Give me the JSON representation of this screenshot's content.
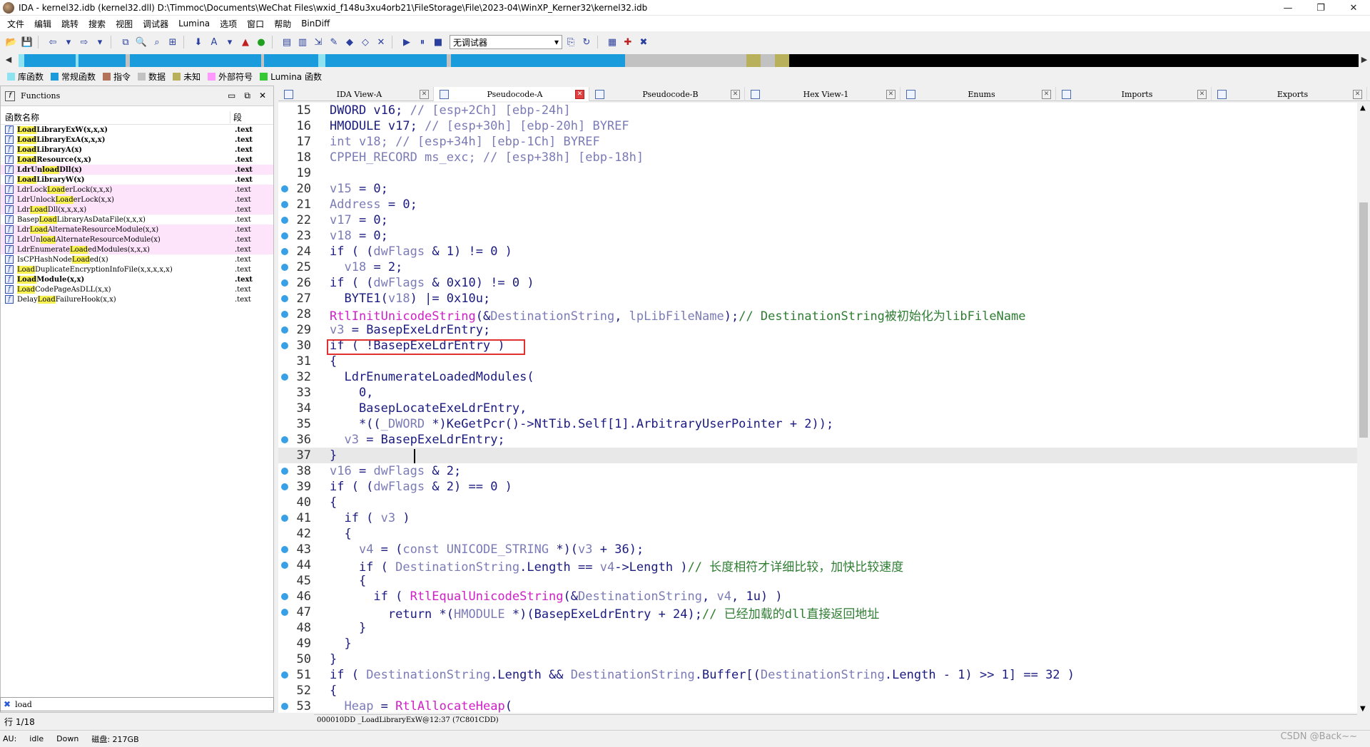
{
  "titlebar": {
    "title": "IDA - kernel32.idb (kernel32.dll) D:\\Timmoc\\Documents\\WeChat Files\\wxid_f148u3xu4orb21\\FileStorage\\File\\2023-04\\WinXP_Kerner32\\kernel32.idb",
    "minimize": "—",
    "maximize": "❐",
    "close": "✕"
  },
  "menubar": [
    "文件",
    "编辑",
    "跳转",
    "搜索",
    "视图",
    "调试器",
    "Lumina",
    "选项",
    "窗口",
    "帮助",
    "BinDiff"
  ],
  "toolbar": {
    "debugger_select": "无调试器",
    "icons": [
      "open-icon",
      "save-icon",
      "back-icon",
      "forward-icon",
      "copy-icon",
      "search-icon",
      "run-icon",
      "pause-icon",
      "stop-icon"
    ]
  },
  "navband": {
    "left_arrow": "◀",
    "right_arrow": "▶",
    "colors": {
      "library": "#8fe3f0",
      "regular": "#1a9bdc",
      "instruction": "#b2735a",
      "data": "#c2c2c2",
      "unexplored": "#b8b05a",
      "external": "#ff99ff",
      "lumina": "#35c935"
    }
  },
  "legend": [
    {
      "label": "库函数",
      "color": "#8fe3f0"
    },
    {
      "label": "常规函数",
      "color": "#1a9bdc"
    },
    {
      "label": "指令",
      "color": "#b2735a"
    },
    {
      "label": "数据",
      "color": "#c2c2c2"
    },
    {
      "label": "未知",
      "color": "#b8b05a"
    },
    {
      "label": "外部符号",
      "color": "#ff99ff"
    },
    {
      "label": "Lumina 函数",
      "color": "#35c935"
    }
  ],
  "functions": {
    "title": "Functions",
    "col_name": "函数名称",
    "col_seg": "段",
    "rows": [
      {
        "pre": "",
        "hl": "Load",
        "post": "LibraryExW(x,x,x)",
        "seg": ".text",
        "bold": true,
        "pink": false
      },
      {
        "pre": "",
        "hl": "Load",
        "post": "LibraryExA(x,x,x)",
        "seg": ".text",
        "bold": true,
        "pink": false
      },
      {
        "pre": "",
        "hl": "Load",
        "post": "LibraryA(x)",
        "seg": ".text",
        "bold": true,
        "pink": false
      },
      {
        "pre": "",
        "hl": "Load",
        "post": "Resource(x,x)",
        "seg": ".text",
        "bold": true,
        "pink": false
      },
      {
        "pre": "LdrUn",
        "hl": "load",
        "post": "Dll(x)",
        "seg": ".text",
        "bold": true,
        "pink": true
      },
      {
        "pre": "",
        "hl": "Load",
        "post": "LibraryW(x)",
        "seg": ".text",
        "bold": true,
        "pink": false
      },
      {
        "pre": "LdrLock",
        "hl": "Load",
        "post": "erLock(x,x,x)",
        "seg": ".text",
        "bold": false,
        "pink": true
      },
      {
        "pre": "LdrUnlock",
        "hl": "Load",
        "post": "erLock(x,x)",
        "seg": ".text",
        "bold": false,
        "pink": true
      },
      {
        "pre": "Ldr",
        "hl": "Load",
        "post": "Dll(x,x,x,x)",
        "seg": ".text",
        "bold": false,
        "pink": true
      },
      {
        "pre": "Basep",
        "hl": "Load",
        "post": "LibraryAsDataFile(x,x,x)",
        "seg": ".text",
        "bold": false,
        "pink": false
      },
      {
        "pre": "Ldr",
        "hl": "Load",
        "post": "AlternateResourceModule(x,x)",
        "seg": ".text",
        "bold": false,
        "pink": true
      },
      {
        "pre": "LdrUn",
        "hl": "load",
        "post": "AlternateResourceModule(x)",
        "seg": ".text",
        "bold": false,
        "pink": true
      },
      {
        "pre": "LdrEnumerate",
        "hl": "Load",
        "post": "edModules(x,x,x)",
        "seg": ".text",
        "bold": false,
        "pink": true
      },
      {
        "pre": "IsCPHashNode",
        "hl": "Load",
        "post": "ed(x)",
        "seg": ".text",
        "bold": false,
        "pink": false
      },
      {
        "pre": "",
        "hl": "Load",
        "post": "DuplicateEncryptionInfoFile(x,x,x,x,x)",
        "seg": ".text",
        "bold": false,
        "pink": false
      },
      {
        "pre": "",
        "hl": "Load",
        "post": "Module(x,x)",
        "seg": ".text",
        "bold": true,
        "pink": false
      },
      {
        "pre": "",
        "hl": "Load",
        "post": "CodePageAsDLL(x,x)",
        "seg": ".text",
        "bold": false,
        "pink": false
      },
      {
        "pre": "Delay",
        "hl": "Load",
        "post": "FailureHook(x,x)",
        "seg": ".text",
        "bold": false,
        "pink": false
      }
    ],
    "filter_value": "load",
    "line_count": "行 1/18"
  },
  "tabs": [
    {
      "label": "IDA View-A",
      "active": false
    },
    {
      "label": "Pseudocode-A",
      "active": true
    },
    {
      "label": "Pseudocode-B",
      "active": false
    },
    {
      "label": "Hex View-1",
      "active": false
    },
    {
      "label": "Enums",
      "active": false
    },
    {
      "label": "Imports",
      "active": false
    },
    {
      "label": "Exports",
      "active": false
    }
  ],
  "code": [
    {
      "n": "15",
      "dot": false,
      "html": "<span class='k'>DWORD v16; </span><span class='g'>// [esp+2Ch] [ebp-24h]</span>"
    },
    {
      "n": "16",
      "dot": false,
      "html": "<span class='k'>HMODULE v17; </span><span class='g'>// [esp+30h] [ebp-20h] BYREF</span>"
    },
    {
      "n": "17",
      "dot": false,
      "html": "<span class='g'>int v18; // [esp+34h] [ebp-1Ch] BYREF</span>"
    },
    {
      "n": "18",
      "dot": false,
      "html": "<span class='g'>CPPEH_RECORD ms_exc; // [esp+38h] [ebp-18h]</span>"
    },
    {
      "n": "19",
      "dot": false,
      "html": ""
    },
    {
      "n": "20",
      "dot": true,
      "html": "<span class='g'>v15</span> = 0;"
    },
    {
      "n": "21",
      "dot": true,
      "html": "<span class='g'>Address</span> = 0;"
    },
    {
      "n": "22",
      "dot": true,
      "html": "<span class='g'>v17</span> = 0;"
    },
    {
      "n": "23",
      "dot": true,
      "html": "<span class='g'>v18</span> = 0;"
    },
    {
      "n": "24",
      "dot": true,
      "html": "if ( (<span class='g'>dwFlags</span> &amp; 1) != 0 )"
    },
    {
      "n": "25",
      "dot": true,
      "html": "  <span class='g'>v18</span> = 2;"
    },
    {
      "n": "26",
      "dot": true,
      "html": "if ( (<span class='g'>dwFlags</span> &amp; 0x10) != 0 )"
    },
    {
      "n": "27",
      "dot": true,
      "html": "  BYTE1(<span class='g'>v18</span>) |= 0x10u;"
    },
    {
      "n": "28",
      "dot": true,
      "html": "<span class='p'>RtlInitUnicodeString</span>(&amp;<span class='g'>DestinationString</span>, <span class='g'>lpLibFileName</span>);<span class='c'>// DestinationString被初始化为libFileName</span>"
    },
    {
      "n": "29",
      "dot": true,
      "html": "<span class='g'>v3</span> = BasepExeLdrEntry;"
    },
    {
      "n": "30",
      "dot": true,
      "html": "if ( !BasepExeLdrEntry )"
    },
    {
      "n": "31",
      "dot": false,
      "html": "{"
    },
    {
      "n": "32",
      "dot": true,
      "html": "  LdrEnumerateLoadedModules("
    },
    {
      "n": "33",
      "dot": false,
      "html": "    0,"
    },
    {
      "n": "34",
      "dot": false,
      "html": "    BasepLocateExeLdrEntry,"
    },
    {
      "n": "35",
      "dot": false,
      "html": "    *((<span class='g'>_DWORD</span> *)KeGetPcr()-&gt;NtTib.Self[1].ArbitraryUserPointer + 2));"
    },
    {
      "n": "36",
      "dot": true,
      "html": "  <span class='g'>v3</span> = BasepExeLdrEntry;"
    },
    {
      "n": "37",
      "dot": false,
      "html": "}"
    },
    {
      "n": "38",
      "dot": true,
      "html": "<span class='g'>v16</span> = <span class='g'>dwFlags</span> &amp; 2;"
    },
    {
      "n": "39",
      "dot": true,
      "html": "if ( (<span class='g'>dwFlags</span> &amp; 2) == 0 )"
    },
    {
      "n": "40",
      "dot": false,
      "html": "{"
    },
    {
      "n": "41",
      "dot": true,
      "html": "  if ( <span class='g'>v3</span> )"
    },
    {
      "n": "42",
      "dot": false,
      "html": "  {"
    },
    {
      "n": "43",
      "dot": true,
      "html": "    <span class='g'>v4</span> = (<span class='g'>const UNICODE_STRING</span> *)(<span class='g'>v3</span> + 36);"
    },
    {
      "n": "44",
      "dot": true,
      "html": "    if ( <span class='g'>DestinationString</span>.Length == <span class='g'>v4</span>-&gt;Length )<span class='c'>// 长度相符才详细比较，加快比较速度</span>"
    },
    {
      "n": "45",
      "dot": false,
      "html": "    {"
    },
    {
      "n": "46",
      "dot": true,
      "html": "      if ( <span class='p'>RtlEqualUnicodeString</span>(&amp;<span class='g'>DestinationString</span>, <span class='g'>v4</span>, 1u) )"
    },
    {
      "n": "47",
      "dot": true,
      "html": "        return *(<span class='g'>HMODULE</span> *)(BasepExeLdrEntry + 24);<span class='c'>// 已经加载的dll直接返回地址</span>"
    },
    {
      "n": "48",
      "dot": false,
      "html": "    }"
    },
    {
      "n": "49",
      "dot": false,
      "html": "  }"
    },
    {
      "n": "50",
      "dot": false,
      "html": "}"
    },
    {
      "n": "51",
      "dot": true,
      "html": "if ( <span class='g'>DestinationString</span>.Length &amp;&amp; <span class='g'>DestinationString</span>.Buffer[(<span class='g'>DestinationString</span>.Length - 1) &gt;&gt; 1] == 32 )"
    },
    {
      "n": "52",
      "dot": false,
      "html": "{"
    },
    {
      "n": "53",
      "dot": true,
      "html": "  <span class='g'>Heap</span> = <span class='p'>RtlAllocateHeap</span>("
    }
  ],
  "address_bar": "000010DD _LoadLibraryExW@12:37 (7C801CDD)",
  "status": {
    "au": "AU:",
    "au_state": "idle",
    "direction": "Down",
    "disk": "磁盘: 217GB"
  },
  "watermark": "CSDN @Back~~"
}
